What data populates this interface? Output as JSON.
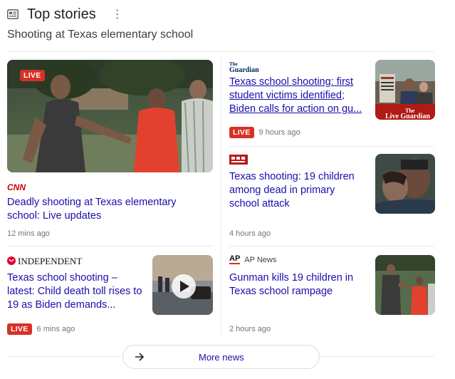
{
  "header": {
    "title": "Top stories",
    "more_glyph": "⋮",
    "icon": "newspaper-icon"
  },
  "topic": "Shooting at Texas elementary school",
  "stories": [
    {
      "source": "CNN",
      "headline": "Deadly shooting at Texas elementary school: Live updates",
      "live": true,
      "thumb_live_label": "LIVE",
      "time": "12 mins ago"
    },
    {
      "source": "The Guardian",
      "source_logo": "The Guardian",
      "headline": "Texas school shooting: first student victims identified; Biden calls for action on gu...",
      "live": true,
      "live_label": "LIVE",
      "time": "9 hours ago",
      "thumb_text": "Live Guardian"
    },
    {
      "source": "BBC News",
      "headline": "Texas shooting: 19 children among dead in primary school attack",
      "live": false,
      "time": "4 hours ago"
    },
    {
      "source": "INDEPENDENT",
      "headline": "Texas school shooting – latest: Child death toll rises to 19 as Biden demands...",
      "live": true,
      "live_label": "LIVE",
      "time": "6 mins ago"
    },
    {
      "source": "AP News",
      "source_mark": "AP",
      "headline": "Gunman kills 19 children in Texas school rampage",
      "live": false,
      "time": "2 hours ago"
    }
  ],
  "more_news": {
    "label": "More news"
  },
  "colors": {
    "link": "#1a0dab",
    "live": "#d93025",
    "meta": "#70757a",
    "divider": "#e8eaed"
  }
}
